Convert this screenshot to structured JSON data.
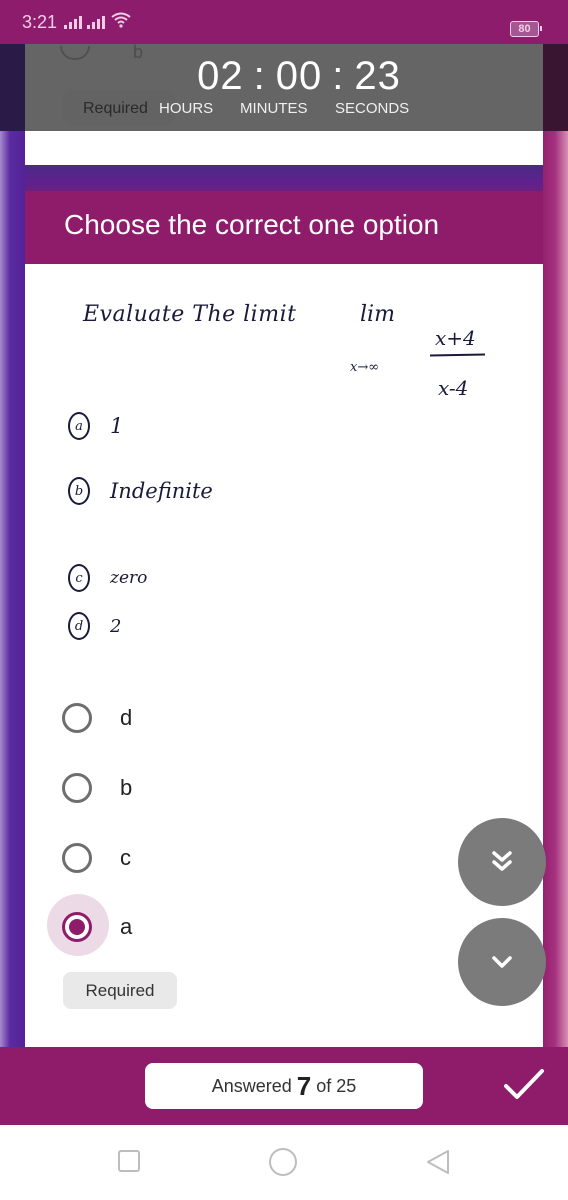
{
  "status_bar": {
    "time": "3:21",
    "battery": "80",
    "icons": [
      "signal-icon",
      "signal-icon",
      "wifi-icon",
      "battery-icon"
    ]
  },
  "previous_question": {
    "visible_option_letter": "b",
    "required_label": "Required"
  },
  "timer": {
    "hours": "02",
    "minutes": "00",
    "seconds": "23",
    "separator": ":",
    "labels": {
      "hours": "HOURS",
      "minutes": "MINUTES",
      "seconds": "SECONDS"
    }
  },
  "question": {
    "header": "Choose the correct one option",
    "image": {
      "prompt": "Evaluate The limit",
      "lim": "lim",
      "lim_subscript": "x→∞",
      "numerator": "x+4",
      "denominator": "x-4",
      "options": [
        {
          "letter": "a",
          "text": "1"
        },
        {
          "letter": "b",
          "text": "Indefinite"
        },
        {
          "letter": "c",
          "text": "zero"
        },
        {
          "letter": "d",
          "text": "2"
        }
      ]
    },
    "answers": [
      {
        "label": "d",
        "selected": false
      },
      {
        "label": "b",
        "selected": false
      },
      {
        "label": "c",
        "selected": false
      },
      {
        "label": "a",
        "selected": true
      }
    ],
    "required_label": "Required"
  },
  "nav_buttons": {
    "jump_icon": "double-chevron-down-icon",
    "next_icon": "chevron-down-icon"
  },
  "footer": {
    "answered_prefix": "Answered",
    "answered_count": "7",
    "answered_suffix": "of 25",
    "submit_icon": "checkmark-icon"
  },
  "colors": {
    "brand": "#8e1c6a",
    "selected_halo": "#ecdbe7",
    "fab_gray": "#7b7b7b"
  }
}
